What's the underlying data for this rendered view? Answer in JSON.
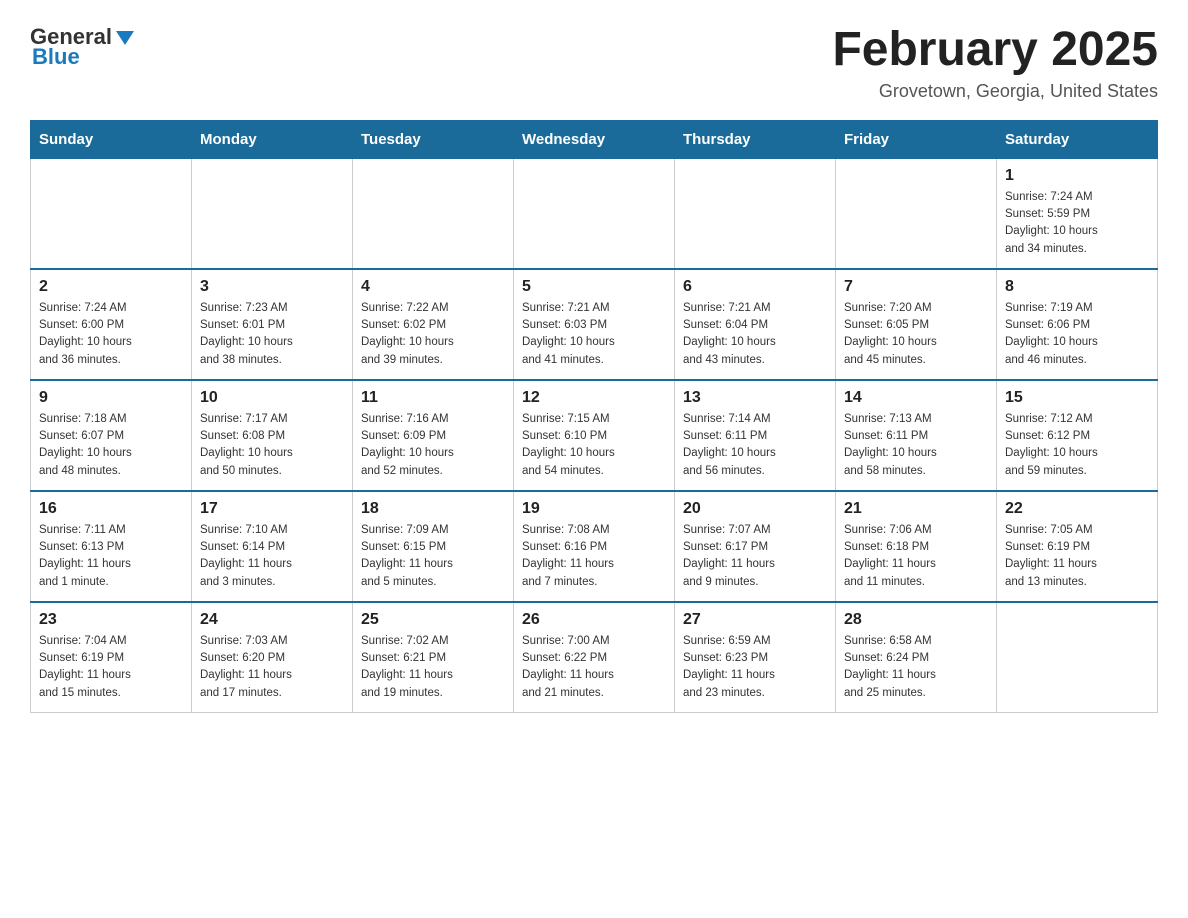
{
  "header": {
    "logo_general": "General",
    "logo_blue": "Blue",
    "month_title": "February 2025",
    "location": "Grovetown, Georgia, United States"
  },
  "days_of_week": [
    "Sunday",
    "Monday",
    "Tuesday",
    "Wednesday",
    "Thursday",
    "Friday",
    "Saturday"
  ],
  "weeks": [
    [
      {
        "day": "",
        "info": ""
      },
      {
        "day": "",
        "info": ""
      },
      {
        "day": "",
        "info": ""
      },
      {
        "day": "",
        "info": ""
      },
      {
        "day": "",
        "info": ""
      },
      {
        "day": "",
        "info": ""
      },
      {
        "day": "1",
        "info": "Sunrise: 7:24 AM\nSunset: 5:59 PM\nDaylight: 10 hours\nand 34 minutes."
      }
    ],
    [
      {
        "day": "2",
        "info": "Sunrise: 7:24 AM\nSunset: 6:00 PM\nDaylight: 10 hours\nand 36 minutes."
      },
      {
        "day": "3",
        "info": "Sunrise: 7:23 AM\nSunset: 6:01 PM\nDaylight: 10 hours\nand 38 minutes."
      },
      {
        "day": "4",
        "info": "Sunrise: 7:22 AM\nSunset: 6:02 PM\nDaylight: 10 hours\nand 39 minutes."
      },
      {
        "day": "5",
        "info": "Sunrise: 7:21 AM\nSunset: 6:03 PM\nDaylight: 10 hours\nand 41 minutes."
      },
      {
        "day": "6",
        "info": "Sunrise: 7:21 AM\nSunset: 6:04 PM\nDaylight: 10 hours\nand 43 minutes."
      },
      {
        "day": "7",
        "info": "Sunrise: 7:20 AM\nSunset: 6:05 PM\nDaylight: 10 hours\nand 45 minutes."
      },
      {
        "day": "8",
        "info": "Sunrise: 7:19 AM\nSunset: 6:06 PM\nDaylight: 10 hours\nand 46 minutes."
      }
    ],
    [
      {
        "day": "9",
        "info": "Sunrise: 7:18 AM\nSunset: 6:07 PM\nDaylight: 10 hours\nand 48 minutes."
      },
      {
        "day": "10",
        "info": "Sunrise: 7:17 AM\nSunset: 6:08 PM\nDaylight: 10 hours\nand 50 minutes."
      },
      {
        "day": "11",
        "info": "Sunrise: 7:16 AM\nSunset: 6:09 PM\nDaylight: 10 hours\nand 52 minutes."
      },
      {
        "day": "12",
        "info": "Sunrise: 7:15 AM\nSunset: 6:10 PM\nDaylight: 10 hours\nand 54 minutes."
      },
      {
        "day": "13",
        "info": "Sunrise: 7:14 AM\nSunset: 6:11 PM\nDaylight: 10 hours\nand 56 minutes."
      },
      {
        "day": "14",
        "info": "Sunrise: 7:13 AM\nSunset: 6:11 PM\nDaylight: 10 hours\nand 58 minutes."
      },
      {
        "day": "15",
        "info": "Sunrise: 7:12 AM\nSunset: 6:12 PM\nDaylight: 10 hours\nand 59 minutes."
      }
    ],
    [
      {
        "day": "16",
        "info": "Sunrise: 7:11 AM\nSunset: 6:13 PM\nDaylight: 11 hours\nand 1 minute."
      },
      {
        "day": "17",
        "info": "Sunrise: 7:10 AM\nSunset: 6:14 PM\nDaylight: 11 hours\nand 3 minutes."
      },
      {
        "day": "18",
        "info": "Sunrise: 7:09 AM\nSunset: 6:15 PM\nDaylight: 11 hours\nand 5 minutes."
      },
      {
        "day": "19",
        "info": "Sunrise: 7:08 AM\nSunset: 6:16 PM\nDaylight: 11 hours\nand 7 minutes."
      },
      {
        "day": "20",
        "info": "Sunrise: 7:07 AM\nSunset: 6:17 PM\nDaylight: 11 hours\nand 9 minutes."
      },
      {
        "day": "21",
        "info": "Sunrise: 7:06 AM\nSunset: 6:18 PM\nDaylight: 11 hours\nand 11 minutes."
      },
      {
        "day": "22",
        "info": "Sunrise: 7:05 AM\nSunset: 6:19 PM\nDaylight: 11 hours\nand 13 minutes."
      }
    ],
    [
      {
        "day": "23",
        "info": "Sunrise: 7:04 AM\nSunset: 6:19 PM\nDaylight: 11 hours\nand 15 minutes."
      },
      {
        "day": "24",
        "info": "Sunrise: 7:03 AM\nSunset: 6:20 PM\nDaylight: 11 hours\nand 17 minutes."
      },
      {
        "day": "25",
        "info": "Sunrise: 7:02 AM\nSunset: 6:21 PM\nDaylight: 11 hours\nand 19 minutes."
      },
      {
        "day": "26",
        "info": "Sunrise: 7:00 AM\nSunset: 6:22 PM\nDaylight: 11 hours\nand 21 minutes."
      },
      {
        "day": "27",
        "info": "Sunrise: 6:59 AM\nSunset: 6:23 PM\nDaylight: 11 hours\nand 23 minutes."
      },
      {
        "day": "28",
        "info": "Sunrise: 6:58 AM\nSunset: 6:24 PM\nDaylight: 11 hours\nand 25 minutes."
      },
      {
        "day": "",
        "info": ""
      }
    ]
  ]
}
